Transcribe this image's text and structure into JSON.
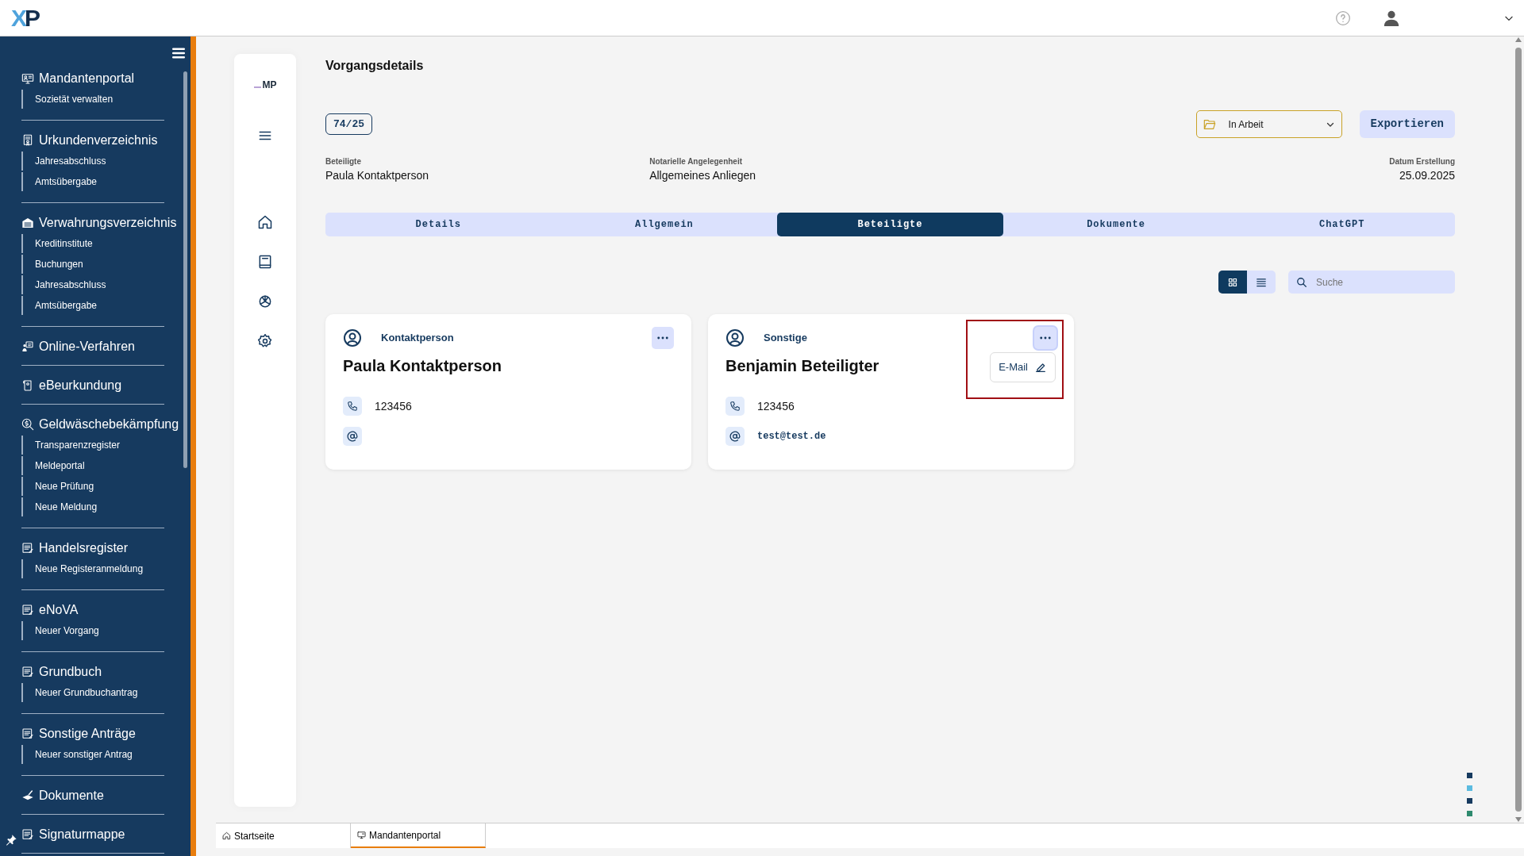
{
  "header": {
    "logo_left": "X",
    "logo_right": "P"
  },
  "sidebar": {
    "groups": [
      {
        "title": "Mandantenportal",
        "children": [
          {
            "label": "Sozietät verwalten"
          }
        ]
      },
      {
        "title": "Urkundenverzeichnis",
        "children": [
          {
            "label": "Jahresabschluss"
          },
          {
            "label": "Amtsübergabe"
          }
        ]
      },
      {
        "title": "Verwahrungsverzeichnis",
        "children": [
          {
            "label": "Kreditinstitute"
          },
          {
            "label": "Buchungen"
          },
          {
            "label": "Jahresabschluss"
          },
          {
            "label": "Amtsübergabe"
          }
        ]
      },
      {
        "title": "Online-Verfahren"
      },
      {
        "title": "eBeurkundung"
      },
      {
        "title": "Geldwäschebekämpfung",
        "children": [
          {
            "label": "Transparenzregister"
          },
          {
            "label": "Meldeportal"
          },
          {
            "label": "Neue Prüfung"
          },
          {
            "label": "Neue Meldung"
          }
        ]
      },
      {
        "title": "Handelsregister",
        "children": [
          {
            "label": "Neue Registeranmeldung"
          }
        ]
      },
      {
        "title": "eNoVA",
        "children": [
          {
            "label": "Neuer Vorgang"
          }
        ]
      },
      {
        "title": "Grundbuch",
        "children": [
          {
            "label": "Neuer Grundbuchantrag"
          }
        ]
      },
      {
        "title": "Sonstige Anträge",
        "children": [
          {
            "label": "Neuer sonstiger Antrag"
          }
        ]
      },
      {
        "title": "Dokumente"
      },
      {
        "title": "Signaturmappe"
      }
    ]
  },
  "rail": {
    "logo": "MP"
  },
  "main": {
    "title": "Vorgangsdetails",
    "case_number": "74/25",
    "status": "In Arbeit",
    "export_button": "Exportieren",
    "fields": [
      {
        "label": "Beteiligte",
        "value": "Paula Kontaktperson"
      },
      {
        "label": "Notarielle Angelegenheit",
        "value": "Allgemeines Anliegen"
      },
      {
        "label": "Datum Erstellung",
        "value": "25.09.2025"
      }
    ],
    "tabs": [
      {
        "label": "Details",
        "selected": false
      },
      {
        "label": "Allgemein",
        "selected": false
      },
      {
        "label": "Beteiligte",
        "selected": true
      },
      {
        "label": "Dokumente",
        "selected": false
      },
      {
        "label": "ChatGPT",
        "selected": false
      }
    ],
    "view_modes": [
      {
        "kind": "grid",
        "selected": true
      },
      {
        "kind": "list",
        "selected": false
      }
    ],
    "search": {
      "placeholder": "Suche"
    },
    "cards": [
      {
        "role": "Kontaktperson",
        "name": "Paula Kontaktperson",
        "phone": "123456",
        "menu_open": false
      },
      {
        "role": "Sonstige",
        "name": "Benjamin Beteiligter",
        "phone": "123456",
        "email": "test@test.de",
        "menu_open": true,
        "menu_items": [
          "E-Mail"
        ],
        "highlighted": true
      }
    ]
  },
  "markers": [
    {
      "color": "#163a5f"
    },
    {
      "color": "#5bbbe0"
    },
    {
      "color": "#163a5f"
    },
    {
      "color": "#2e8a6e"
    }
  ],
  "bottom_tabs": [
    {
      "label": "Startseite",
      "selected": false
    },
    {
      "label": "Mandantenportal",
      "selected": true
    }
  ]
}
